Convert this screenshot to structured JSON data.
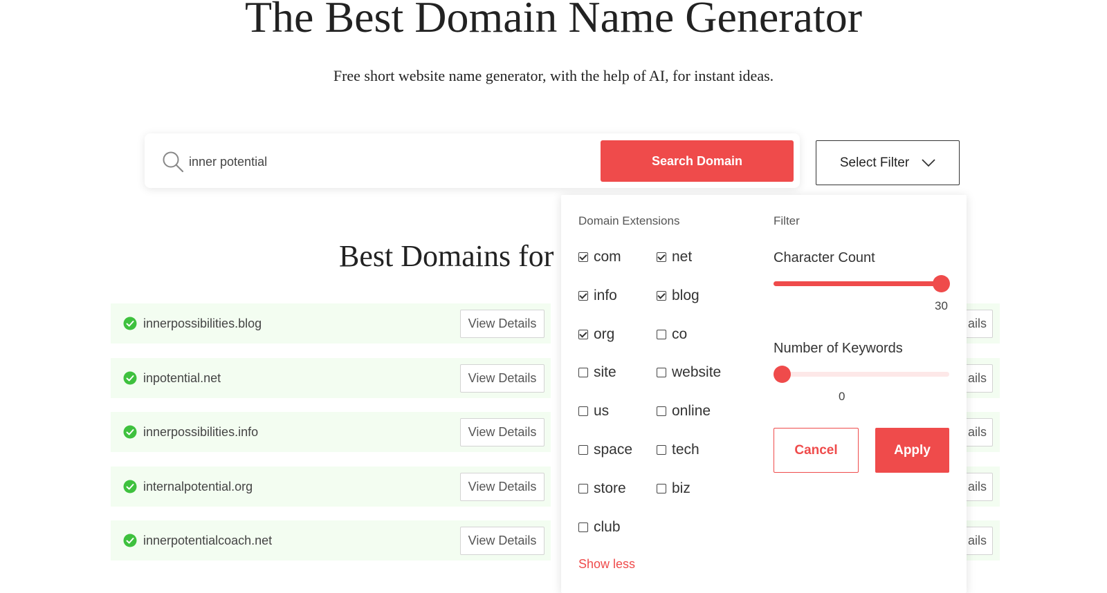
{
  "hero": {
    "title": "The Best Domain Name Generator",
    "subtitle": "Free short website name generator, with the help of AI, for instant ideas."
  },
  "search": {
    "value": "inner potential",
    "button_label": "Search Domain"
  },
  "filter_button": {
    "label": "Select Filter"
  },
  "results": {
    "heading": "Best Domains for",
    "view_details_label": "View Details",
    "partial_label": "ails",
    "items": [
      {
        "domain": "innerpossibilities.blog"
      },
      {
        "domain": "inpotential.net"
      },
      {
        "domain": "innerpossibilities.info"
      },
      {
        "domain": "internalpotential.org"
      },
      {
        "domain": "innerpotentialcoach.net"
      }
    ]
  },
  "filter_panel": {
    "extensions_heading": "Domain Extensions",
    "filter_heading": "Filter",
    "extensions": [
      {
        "label": "com",
        "checked": true
      },
      {
        "label": "net",
        "checked": true
      },
      {
        "label": "info",
        "checked": true
      },
      {
        "label": "blog",
        "checked": true
      },
      {
        "label": "org",
        "checked": true
      },
      {
        "label": "co",
        "checked": false
      },
      {
        "label": "site",
        "checked": false
      },
      {
        "label": "website",
        "checked": false
      },
      {
        "label": "us",
        "checked": false
      },
      {
        "label": "online",
        "checked": false
      },
      {
        "label": "space",
        "checked": false
      },
      {
        "label": "tech",
        "checked": false
      },
      {
        "label": "store",
        "checked": false
      },
      {
        "label": "biz",
        "checked": false
      },
      {
        "label": "club",
        "checked": false
      }
    ],
    "show_less_label": "Show less",
    "character_count": {
      "label": "Character Count",
      "value": "30",
      "fraction": 1.0
    },
    "keywords": {
      "label": "Number of Keywords",
      "value": "0",
      "fraction": 0.0
    },
    "cancel_label": "Cancel",
    "apply_label": "Apply"
  },
  "colors": {
    "accent": "#ef4b4b",
    "row_background": "#f3fdf1",
    "check": "#3ec13e"
  }
}
